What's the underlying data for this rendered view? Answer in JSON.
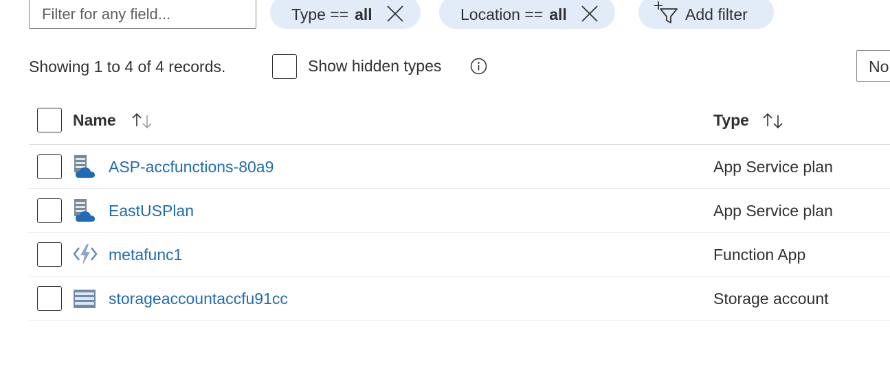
{
  "filter": {
    "placeholder": "Filter for any field..."
  },
  "pills": [
    {
      "label": "Type ==",
      "value": "all"
    },
    {
      "label": "Location ==",
      "value": "all"
    }
  ],
  "add_filter_label": "Add filter",
  "records_text": "Showing 1 to 4 of 4 records.",
  "show_hidden_label": "Show hidden types",
  "right_control_text": "No",
  "table": {
    "columns": [
      "Name",
      "Type"
    ],
    "rows": [
      {
        "name": "ASP-accfunctions-80a9",
        "type": "App Service plan",
        "icon": "app-service-plan-icon"
      },
      {
        "name": "EastUSPlan",
        "type": "App Service plan",
        "icon": "app-service-plan-icon"
      },
      {
        "name": "metafunc1",
        "type": "Function App",
        "icon": "function-app-icon"
      },
      {
        "name": "storageaccountaccfu91cc",
        "type": "Storage account",
        "icon": "storage-account-icon"
      }
    ]
  },
  "colors": {
    "link": "#1f6bb5",
    "pill_bg": "#e1ecf8",
    "text": "#323130",
    "border": "#8a8886"
  }
}
